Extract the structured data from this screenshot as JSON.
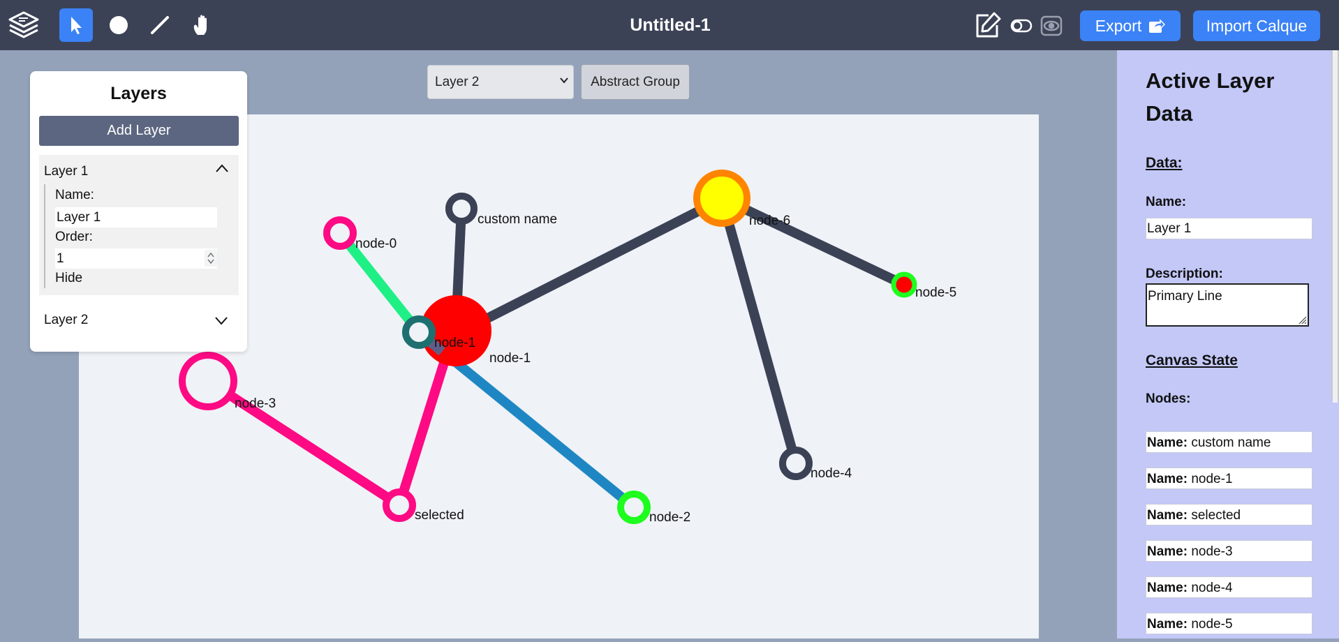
{
  "toolbar": {
    "tools": [
      "select-tool",
      "node-tool",
      "edge-tool",
      "pan-tool"
    ],
    "title": "Untitled-1",
    "export_label": "Export",
    "import_label": "Import Calque",
    "accent": "#3b82f6",
    "bar_color": "#3c4256"
  },
  "layer_selector": {
    "selected": "Layer 2",
    "group_button": "Abstract Group"
  },
  "layers_panel": {
    "title": "Layers",
    "add_button": "Add Layer",
    "items": [
      {
        "label": "Layer 1",
        "expanded": true,
        "name_label": "Name:",
        "name_value": "Layer 1",
        "order_label": "Order:",
        "order_value": "1",
        "hide_label": "Hide"
      },
      {
        "label": "Layer 2",
        "expanded": false
      }
    ]
  },
  "graph": {
    "node_labels": {
      "custom": "custom name",
      "node0": "node-0",
      "node1a": "node-1",
      "node1b": "node-1",
      "node2": "node-2",
      "node3": "node-3",
      "node4": "node-4",
      "node5": "node-5",
      "node6": "node-6",
      "selected": "selected"
    },
    "colors": {
      "edge_default": "#3c4256",
      "edge_green": "#1ff086",
      "edge_pink": "#fe0a84",
      "edge_blue": "#1e87c3",
      "node_red": "#ff0000",
      "node_yellow": "#ffff00",
      "node_orange": "#ff8400",
      "node_teal": "#1e7070",
      "node_lime": "#1efd1e"
    }
  },
  "active_layer": {
    "title": "Active Layer Data",
    "data_heading": "Data:",
    "name_label": "Name:",
    "name_value": "Layer 1",
    "description_label": "Description:",
    "description_value": "Primary Line",
    "canvas_heading": "Canvas State",
    "nodes_label": "Nodes:",
    "node_prefix": "Name:",
    "nodes": [
      "custom name",
      "node-1",
      "selected",
      "node-3",
      "node-4",
      "node-5"
    ]
  }
}
